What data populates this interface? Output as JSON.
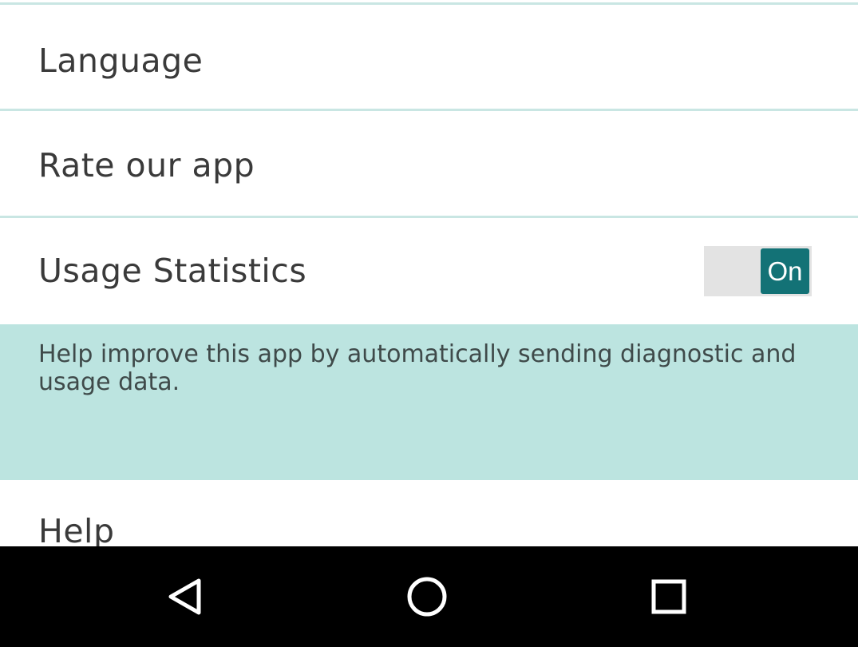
{
  "settings": {
    "items": [
      {
        "label": "Language"
      },
      {
        "label": "Rate our app"
      },
      {
        "label": "Usage Statistics",
        "toggle": {
          "state_label": "On",
          "on": true
        }
      },
      {
        "label": "Help"
      }
    ],
    "usage_description": "Help improve this app by automatically sending diagnostic and usage data."
  },
  "colors": {
    "accent": "#137276",
    "divider": "#c9e6e3",
    "description_background": "#bce4e0",
    "toggle_track": "#e3e3e3",
    "navbar": "#000000"
  },
  "navbar": {
    "buttons": [
      {
        "icon": "back-triangle-icon"
      },
      {
        "icon": "home-circle-icon"
      },
      {
        "icon": "recents-square-icon"
      }
    ]
  }
}
